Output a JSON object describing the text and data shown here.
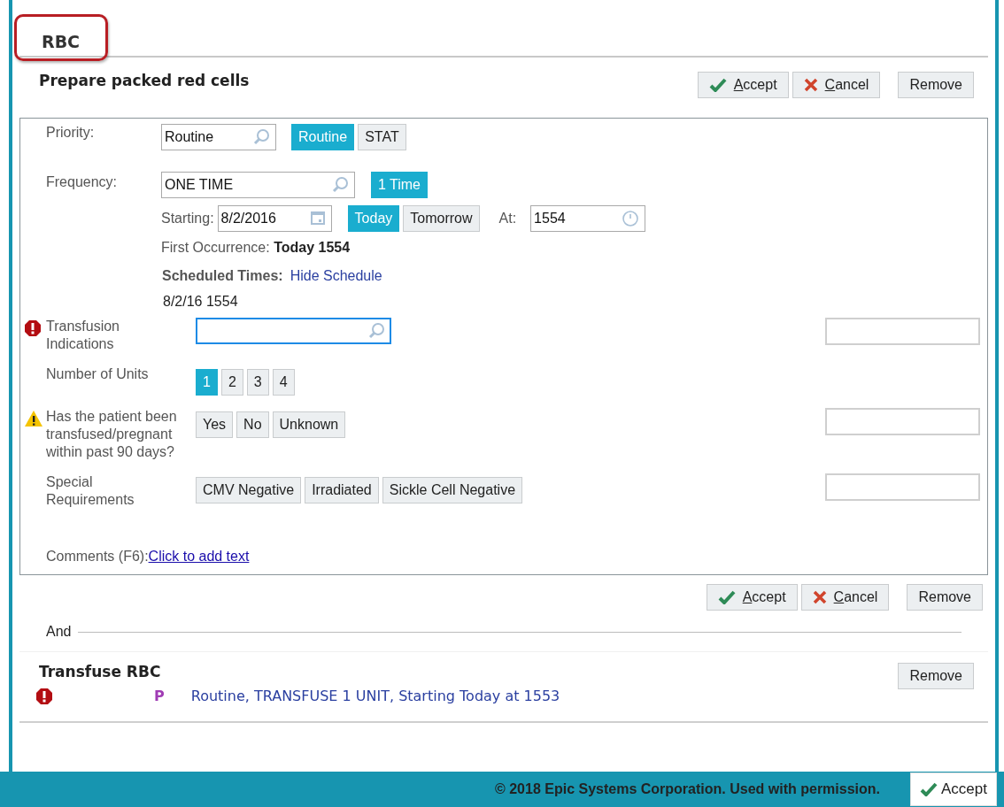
{
  "tab": {
    "label": "RBC",
    "highlighted": true
  },
  "order": {
    "title": "Prepare packed red cells",
    "actions": [
      {
        "label": "Accept",
        "kind": "accept",
        "mnemonic": true
      },
      {
        "label": "Cancel",
        "kind": "cancel",
        "mnemonic": true
      },
      {
        "label": "Remove",
        "kind": "remove",
        "mnemonic": false
      }
    ]
  },
  "priority": {
    "label": "Priority:",
    "value": "Routine",
    "options": [
      {
        "label": "Routine",
        "selected": true
      },
      {
        "label": "STAT",
        "selected": false
      }
    ]
  },
  "frequency": {
    "label": "Frequency:",
    "value": "ONE TIME",
    "options": [
      {
        "label": "1 Time",
        "selected": true
      }
    ],
    "starting_label": "Starting:",
    "starting_value": "8/2/2016",
    "day_options": [
      {
        "label": "Today",
        "selected": true
      },
      {
        "label": "Tomorrow",
        "selected": false
      }
    ],
    "at_label": "At:",
    "at_value": "1554",
    "first_occurrence_label": "First Occurrence:",
    "first_occurrence_value": "Today 1554",
    "scheduled_label": "Scheduled Times:",
    "schedule_link": "Hide Schedule",
    "schedule_times": [
      "8/2/16 1554"
    ]
  },
  "questions": [
    {
      "label": "Transfusion Indications",
      "has_error": true,
      "kind": "search",
      "focused": true,
      "comment_box": true
    },
    {
      "label": "Number of Units",
      "kind": "choices",
      "comment_box": false,
      "options": [
        {
          "label": "1",
          "selected": true
        },
        {
          "label": "2",
          "selected": false
        },
        {
          "label": "3",
          "selected": false
        },
        {
          "label": "4",
          "selected": false
        }
      ]
    },
    {
      "label": "Has the patient been transfused/pregnant within past 90 days?",
      "has_warning": true,
      "kind": "choices",
      "comment_box": true,
      "options": [
        {
          "label": "Yes",
          "selected": false
        },
        {
          "label": "No",
          "selected": false
        },
        {
          "label": "Unknown",
          "selected": false
        }
      ]
    },
    {
      "label": "Special Requirements",
      "kind": "choices",
      "comment_box": true,
      "options": [
        {
          "label": "CMV Negative",
          "selected": false
        },
        {
          "label": "Irradiated",
          "selected": false
        },
        {
          "label": "Sickle Cell Negative",
          "selected": false
        }
      ]
    }
  ],
  "comments": {
    "label": "Comments (F6):",
    "link": "Click to add text"
  },
  "bottom_actions": [
    {
      "label": "Accept",
      "kind": "accept",
      "mnemonic": true
    },
    {
      "label": "Cancel",
      "kind": "cancel",
      "mnemonic": true
    },
    {
      "label": "Remove",
      "kind": "remove",
      "mnemonic": false
    }
  ],
  "separator": "And",
  "linked_order": {
    "title": "Transfuse RBC",
    "action": "Remove",
    "has_error": true,
    "badge": "P",
    "summary": "Routine, TRANSFUSE 1 UNIT, Starting Today at 1553"
  },
  "footer": {
    "copyright": "© 2018 Epic Systems Corporation. Used with permission.",
    "button": "Accept"
  }
}
